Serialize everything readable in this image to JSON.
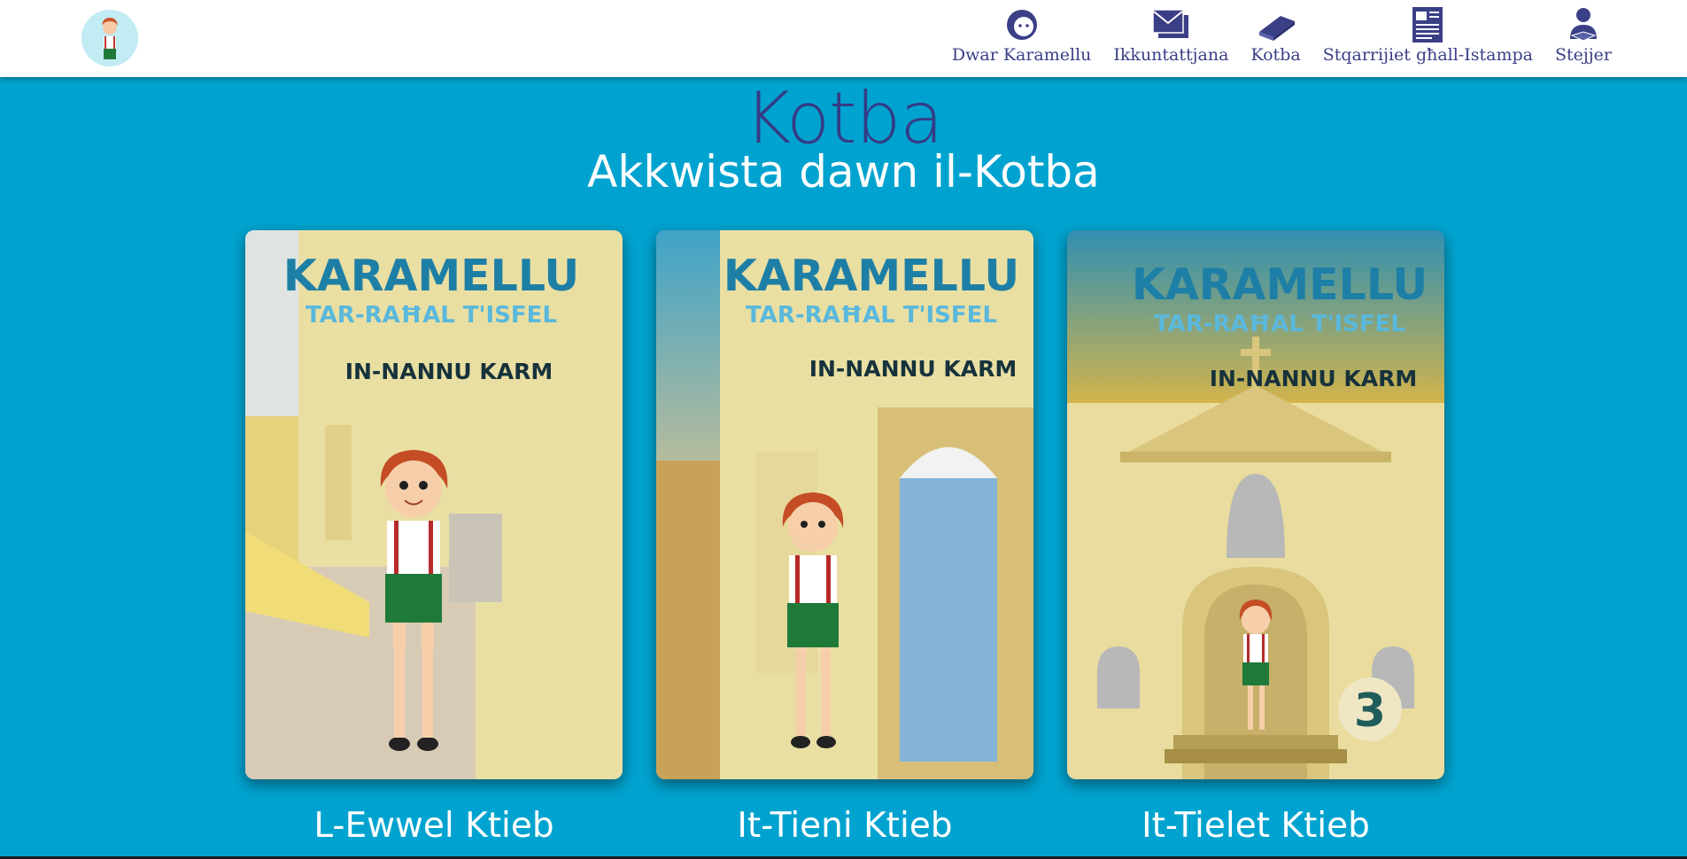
{
  "header": {
    "logo_icon": "karamellu-boy-avatar",
    "nav": [
      {
        "label": "Dwar Karamellu",
        "icon": "face-icon"
      },
      {
        "label": "Ikkuntattjana",
        "icon": "envelope-icon"
      },
      {
        "label": "Kotba",
        "icon": "book-icon"
      },
      {
        "label": "Stqarrijiet għall-Istampa",
        "icon": "newspaper-icon"
      },
      {
        "label": "Stejjer",
        "icon": "reader-icon"
      }
    ]
  },
  "main": {
    "title": "Kotba",
    "subtitle": "Akkwista dawn il-Kotba"
  },
  "books": [
    {
      "series": "KARAMELLU",
      "tagline": "TAR-RAĦAL T'ISFEL",
      "author": "IN-NANNU KARM",
      "caption": "L-Ewwel Ktieb"
    },
    {
      "series": "KARAMELLU",
      "tagline": "TAR-RAĦAL T'ISFEL",
      "author": "IN-NANNU KARM",
      "caption": "It-Tieni Ktieb"
    },
    {
      "series": "KARAMELLU",
      "tagline": "TAR-RAĦAL T'ISFEL",
      "author": "IN-NANNU KARM",
      "caption": "It-Tielet Ktieb",
      "number": "3"
    }
  ],
  "colors": {
    "background": "#00a3cf",
    "nav_text": "#3a3f86",
    "title": "#353b86",
    "cover_title": "#1e7fa6",
    "cover_tagline": "#5ab8dc",
    "cover_author": "#16323b"
  }
}
